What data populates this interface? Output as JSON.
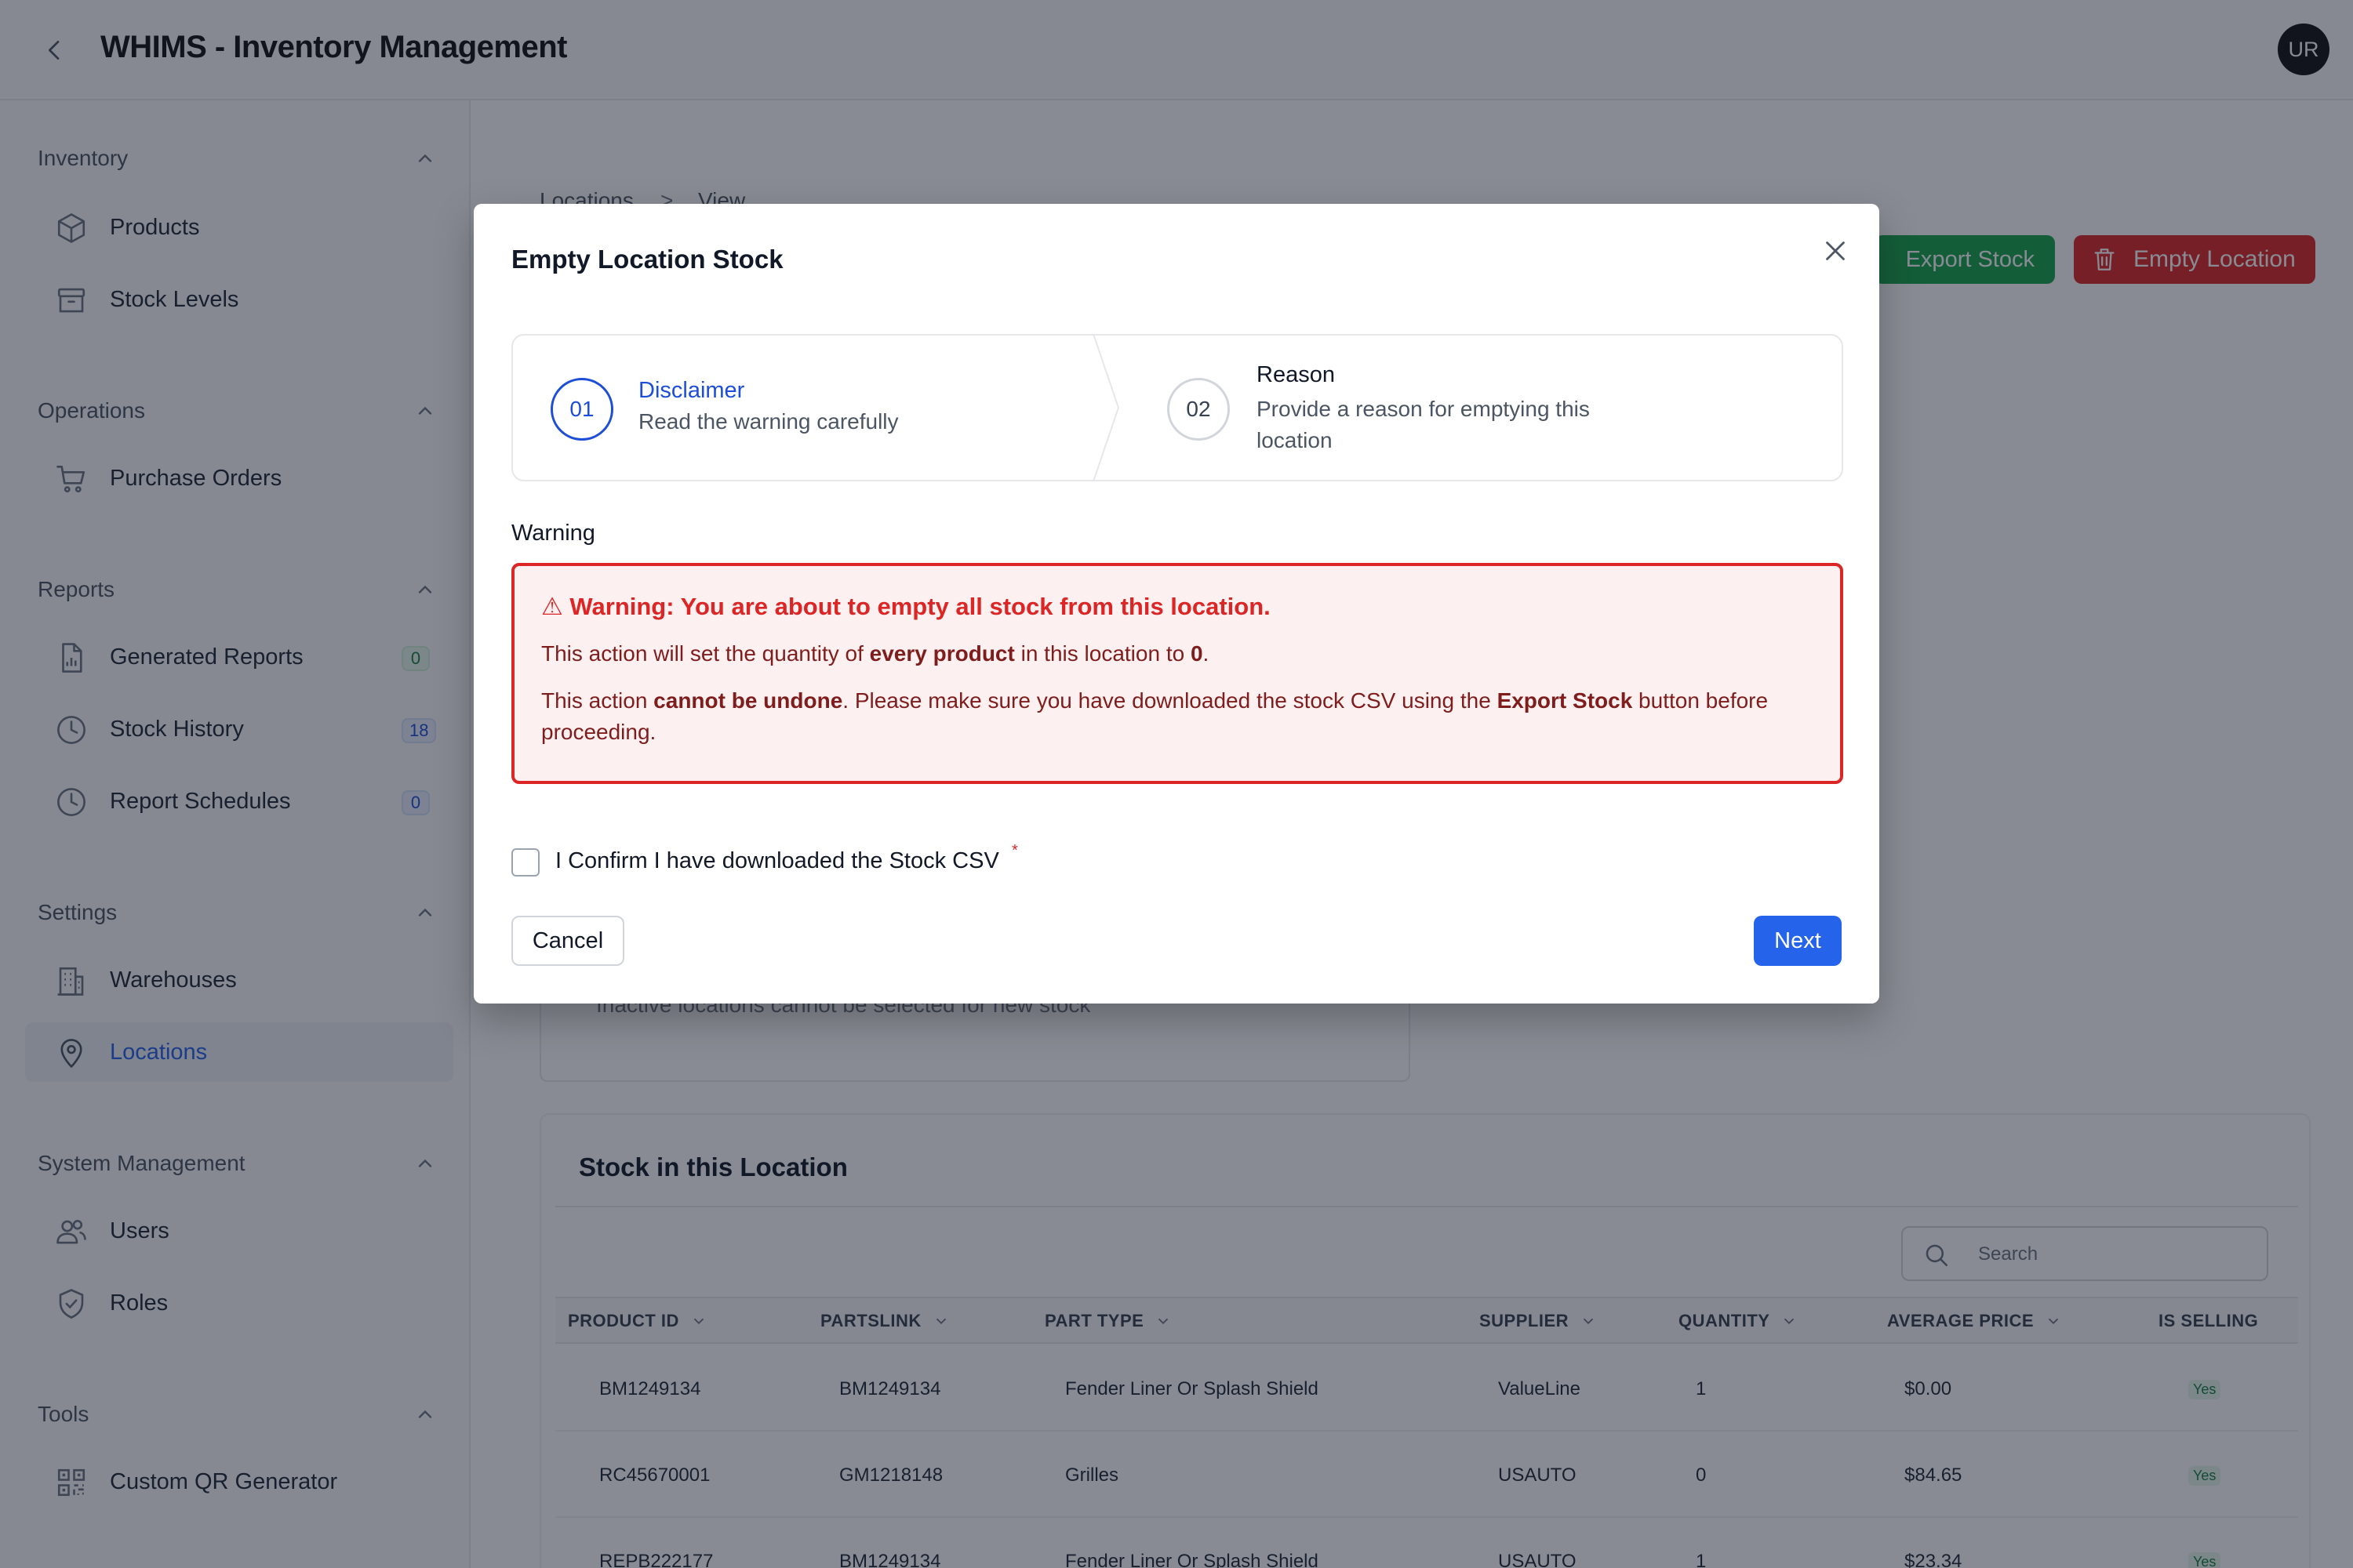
{
  "header": {
    "title": "WHIMS - Inventory Management",
    "avatar_initials": "UR"
  },
  "sidebar": {
    "sections": [
      {
        "title": "Inventory",
        "items": [
          {
            "label": "Products",
            "icon": "box-icon"
          },
          {
            "label": "Stock Levels",
            "icon": "archive-icon"
          }
        ]
      },
      {
        "title": "Operations",
        "items": [
          {
            "label": "Purchase Orders",
            "icon": "cart-icon"
          }
        ]
      },
      {
        "title": "Reports",
        "items": [
          {
            "label": "Generated Reports",
            "icon": "report-icon",
            "badge": "0"
          },
          {
            "label": "Stock History",
            "icon": "clock-icon",
            "badge": "18"
          },
          {
            "label": "Report Schedules",
            "icon": "clock-icon",
            "badge": "0"
          }
        ]
      },
      {
        "title": "Settings",
        "items": [
          {
            "label": "Warehouses",
            "icon": "building-icon"
          },
          {
            "label": "Locations",
            "icon": "map-pin-icon",
            "active": true
          }
        ]
      },
      {
        "title": "System Management",
        "items": [
          {
            "label": "Users",
            "icon": "users-icon"
          },
          {
            "label": "Roles",
            "icon": "shield-icon"
          }
        ]
      },
      {
        "title": "Tools",
        "items": [
          {
            "label": "Custom QR Generator",
            "icon": "qr-icon"
          }
        ]
      }
    ]
  },
  "breadcrumb": {
    "parent": "Locations",
    "separator": ">",
    "current": "View"
  },
  "actions": {
    "export_stock": "Export Stock",
    "empty_location": "Empty Location"
  },
  "info_card": {
    "note": "Inactive locations cannot be selected for new stock"
  },
  "stock": {
    "title": "Stock in this Location",
    "search_placeholder": "Search",
    "columns": [
      "PRODUCT ID",
      "PARTSLINK",
      "PART TYPE",
      "SUPPLIER",
      "QUANTITY",
      "AVERAGE PRICE",
      "IS SELLING"
    ],
    "rows": [
      {
        "product_id": "BM1249134",
        "partslink": "BM1249134",
        "part_type": "Fender Liner Or Splash Shield",
        "supplier": "ValueLine",
        "quantity": "1",
        "avg_price": "$0.00",
        "is_selling": "Yes"
      },
      {
        "product_id": "RC45670001",
        "partslink": "GM1218148",
        "part_type": "Grilles",
        "supplier": "USAUTO",
        "quantity": "0",
        "avg_price": "$84.65",
        "is_selling": "Yes"
      },
      {
        "product_id": "REPB222177",
        "partslink": "BM1249134",
        "part_type": "Fender Liner Or Splash Shield",
        "supplier": "USAUTO",
        "quantity": "1",
        "avg_price": "$23.34",
        "is_selling": "Yes"
      }
    ]
  },
  "modal": {
    "title": "Empty Location Stock",
    "steps": [
      {
        "number": "01",
        "title": "Disclaimer",
        "description": "Read the warning carefully"
      },
      {
        "number": "02",
        "title": "Reason",
        "description": "Provide a reason for emptying this location"
      }
    ],
    "warning_label": "Warning",
    "warning": {
      "heading": "⚠ Warning: You are about to empty all stock from this location.",
      "line1_a": "This action will set the quantity of ",
      "line1_b": "every product",
      "line1_c": " in this location to ",
      "line1_d": "0",
      "line1_e": ".",
      "line2_a": "This action ",
      "line2_b": "cannot be undone",
      "line2_c": ". Please make sure you have downloaded the stock CSV using the ",
      "line2_d": "Export Stock",
      "line2_e": " button before proceeding."
    },
    "confirm_label": "I Confirm I have downloaded the Stock CSV",
    "required_mark": "*",
    "cancel_label": "Cancel",
    "next_label": "Next"
  },
  "colors": {
    "primary": "#2563eb",
    "danger": "#dc2626",
    "success": "#16a34a"
  }
}
